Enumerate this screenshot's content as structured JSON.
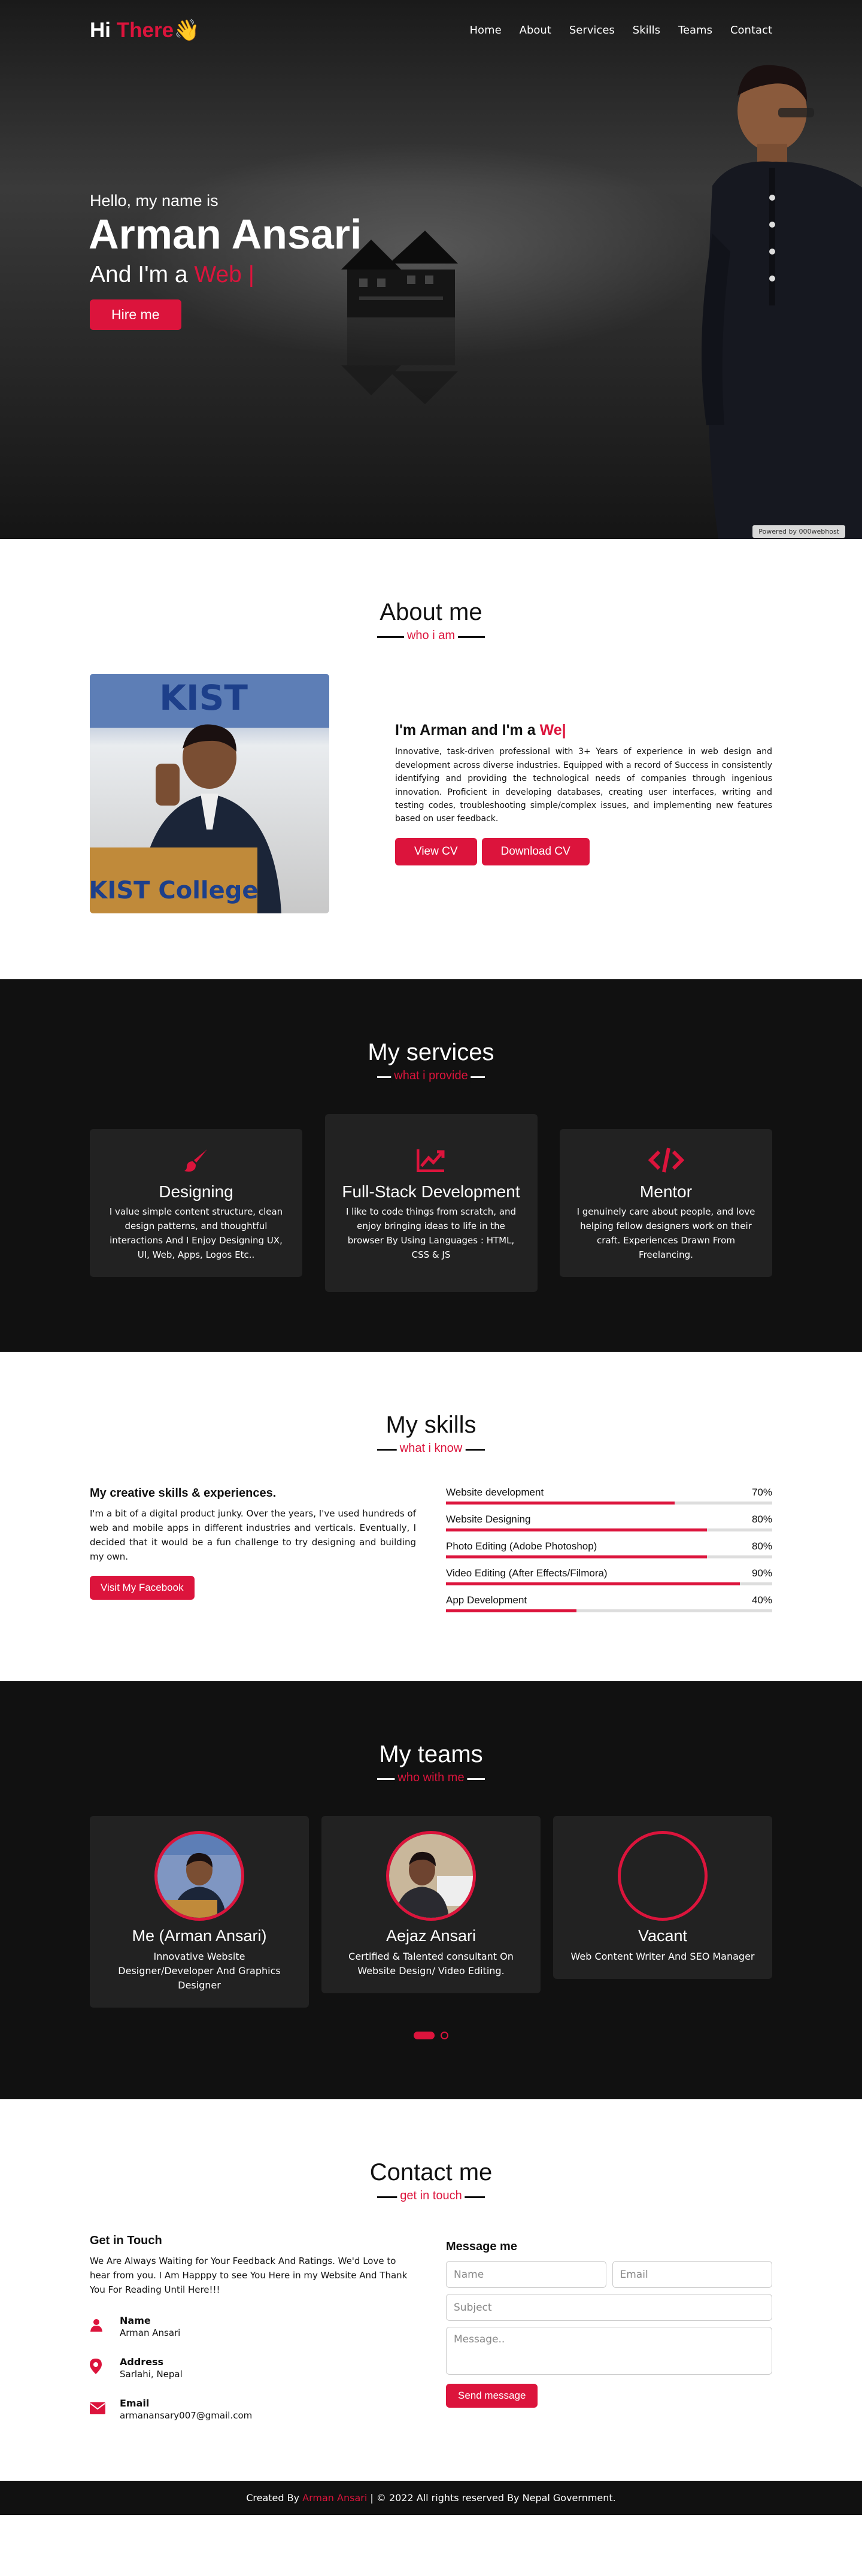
{
  "nav": {
    "logo_hi": "Hi",
    "logo_there": "There",
    "logo_wave": "👋",
    "links": [
      "Home",
      "About",
      "Services",
      "Skills",
      "Teams",
      "Contact"
    ]
  },
  "home": {
    "greeting": "Hello, my name is",
    "name": "Arman Ansari",
    "and_im": "And I'm a",
    "typed": "Web |",
    "hire": "Hire me",
    "powered": "Powered by  000webhost"
  },
  "about": {
    "title": "About me",
    "subtitle": "who i am",
    "heading_pre": "I'm Arman and I'm a",
    "heading_typed": "We|",
    "paragraph": "Innovative, task-driven professional with 3+ Years of experience in web design and development across diverse industries. Equipped with a record of Success in consistently identifying and providing the technological needs of companies through ingenious innovation. Proficient in developing databases, creating user interfaces, writing and testing codes, troubleshooting simple/complex issues, and implementing new features based on user feedback.",
    "view_cv": "View CV",
    "download_cv": "Download CV",
    "photo_banner": "KIST College",
    "photo_top": "KIST"
  },
  "services": {
    "title": "My services",
    "subtitle": "what i provide",
    "cards": [
      {
        "name": "Designing",
        "desc": "I value simple content structure, clean design patterns, and thoughtful interactions And I Enjoy Designing UX, UI, Web, Apps, Logos Etc.."
      },
      {
        "name": "Full-Stack Development",
        "desc": "I like to code things from scratch, and enjoy bringing ideas to life in the browser By Using Languages : HTML, CSS & JS"
      },
      {
        "name": "Mentor",
        "desc": "I genuinely care about people, and love helping fellow designers work on their craft. Experiences Drawn From Freelancing."
      }
    ]
  },
  "skills": {
    "title": "My skills",
    "subtitle": "what i know",
    "heading": "My creative skills & experiences.",
    "paragraph": "I'm a bit of a digital product junky. Over the years, I've used hundreds of web and mobile apps in different industries and verticals. Eventually, I decided that it would be a fun challenge to try designing and building my own.",
    "button": "Visit My Facebook",
    "bars": [
      {
        "name": "Website development",
        "percent": "70%",
        "value": 70
      },
      {
        "name": "Website Designing",
        "percent": "80%",
        "value": 80
      },
      {
        "name": "Photo Editing (Adobe Photoshop)",
        "percent": "80%",
        "value": 80
      },
      {
        "name": "Video Editing (After Effects/Filmora)",
        "percent": "90%",
        "value": 90
      },
      {
        "name": "App Development",
        "percent": "40%",
        "value": 40
      }
    ]
  },
  "teams": {
    "title": "My teams",
    "subtitle": "who with me",
    "members": [
      {
        "name": "Me (Arman Ansari)",
        "desc": "Innovative Website Designer/Developer And Graphics Designer"
      },
      {
        "name": "Aejaz Ansari",
        "desc": "Certified & Talented consultant On Website Design/ Video Editing."
      },
      {
        "name": "Vacant",
        "desc": "Web Content Writer And SEO Manager"
      }
    ]
  },
  "contact": {
    "title": "Contact me",
    "subtitle": "get in touch",
    "heading": "Get in Touch",
    "paragraph": "We Are Always Waiting for Your Feedback And Ratings. We'd Love to hear from you. I Am Happpy to see You Here in my Website And Thank You For Reading Until Here!!!",
    "items": [
      {
        "head": "Name",
        "value": "Arman Ansari"
      },
      {
        "head": "Address",
        "value": "Sarlahi, Nepal"
      },
      {
        "head": "Email",
        "value": "armanansary007@gmail.com"
      }
    ],
    "form_heading": "Message me",
    "name_placeholder": "Name",
    "email_placeholder": "Email",
    "subject_placeholder": "Subject",
    "message_placeholder": "Message..",
    "send": "Send message"
  },
  "footer": {
    "pre": "Created By",
    "name": "Arman Ansari",
    "post": "| © 2022 All rights reserved By Nepal Government."
  },
  "colors": {
    "accent": "#dc143c",
    "dark": "#111111",
    "card": "#222222"
  }
}
